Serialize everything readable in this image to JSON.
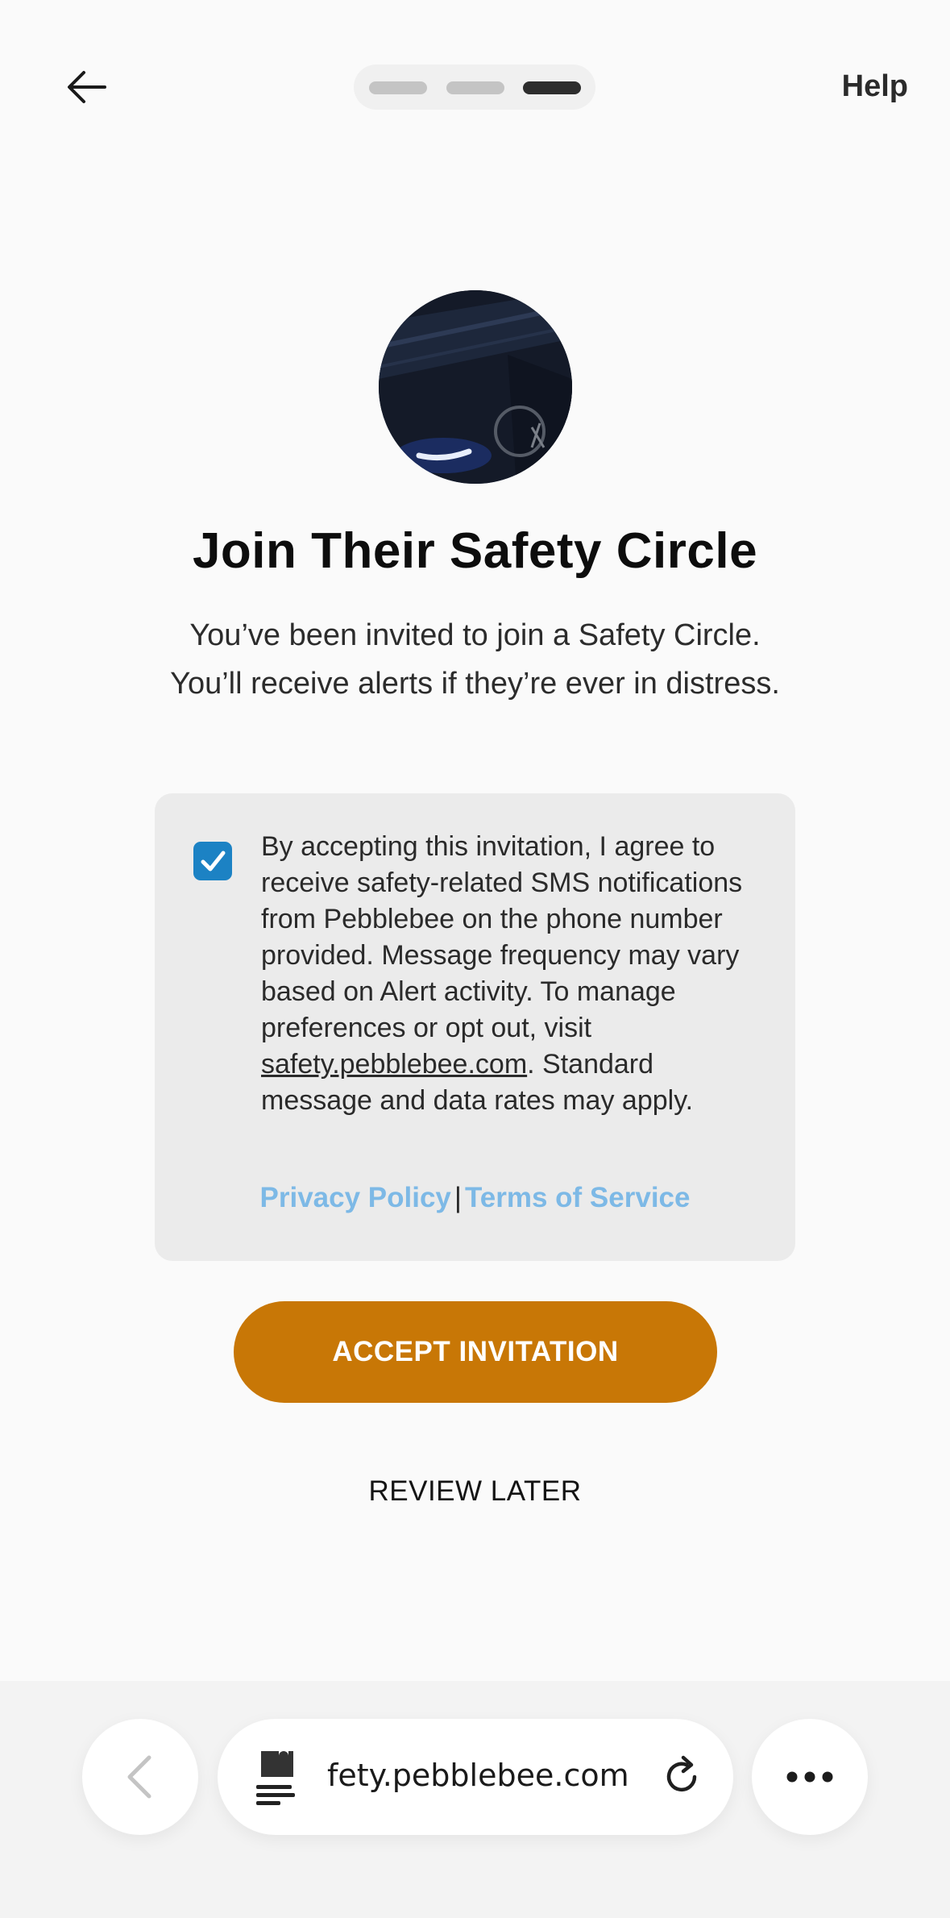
{
  "header": {
    "back_icon": "arrow-left-icon",
    "step_count": 3,
    "current_step": 3,
    "help_label": "Help"
  },
  "main": {
    "avatar_icon": "safety-device-photo",
    "title": "Join Their Safety Circle",
    "subtitle": "You’ve been invited to join a Safety Circle. You’ll receive alerts if they’re ever in distress."
  },
  "consent": {
    "checked": true,
    "text_before_link": "By accepting this invitation, I agree to receive safety-related SMS notifications from Pebblebee on the phone number provided. Message frequency may vary based on Alert activity. To manage preferences or opt out, visit ",
    "link_text": "safety.pebblebee.com",
    "text_after_link": ". Standard message and data rates may apply.",
    "privacy_label": "Privacy Policy",
    "separator": "|",
    "terms_label": "Terms of Service"
  },
  "actions": {
    "accept_label": "ACCEPT INVITATION",
    "review_later_label": "REVIEW LATER"
  },
  "browser": {
    "url_display": "fety.pebblebee.com",
    "back_icon": "chevron-left-icon",
    "tab_icon": "extension-tab-icon",
    "reload_icon": "reload-icon",
    "more_icon": "more-icon"
  },
  "colors": {
    "accent": "#c87706",
    "checkbox": "#1c82c4",
    "link": "#7db9e6",
    "background": "#fafafa",
    "card": "#ebebeb"
  }
}
